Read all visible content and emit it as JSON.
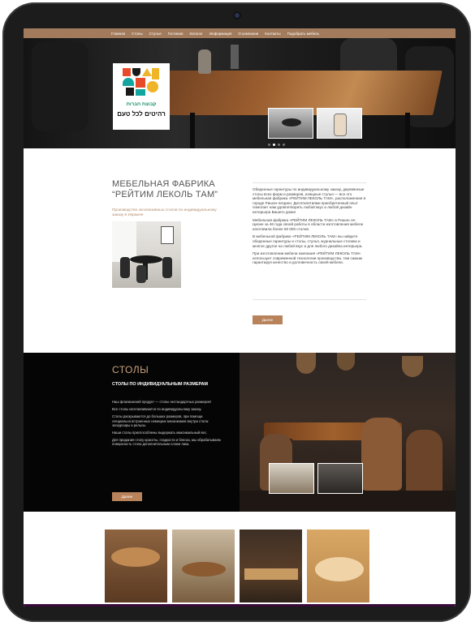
{
  "nav": {
    "items": [
      "Главная",
      "Столы",
      "Стулья",
      "Гостиная",
      "Каталог",
      "Информация",
      "О компании",
      "Контакты",
      "Подобрать мебель"
    ]
  },
  "logo": {
    "line1": "קבוצת חברות",
    "line2": "רהיטים לכל טעם"
  },
  "about": {
    "title": "МЕБЕЛЬНАЯ ФАБРИКА “РЕЙТИМ ЛЕКОЛЬ ТАМ”",
    "subtitle": "Производство эксклюзивных столов по индивидуальному заказу в Израиле",
    "paragraphs": [
      "Обеденные гарнитуры по индивидуальному заказу, деревянные столы всех форм и размеров, изящные стулья — все это мебельная фабрика «РЕЙТИМ ЛЕКОЛЬ ТАМ», расположенная в городе Ришон-леЦион. Десятилетиями приобретенный опыт помогает нам удовлетворить любой вкус и любой дизайн интерьера Вашего дома!",
      "Мебельная фабрика «РЕЙТИМ ЛЕКОЛЬ ТАМ» в Ришон ле-Ционе за 46 года своей работы в области изготовления мебели изготовила более 50 000 столов.",
      "В мебельной фабрике «РЕЙТИМ ЛЕКОЛЬ ТАМ» вы найдете обеденные гарнитуры и столы, стулья, журнальные столики и многое другое на любой вкус и для любого дизайна интерьера.",
      "При изготовлении мебели компания «РЕЙТИМ ЛЕКОЛЬ ТАМ» использует современной технологии производства, тем самым гарантируя качество и долговечность своей мебели."
    ],
    "button": "Далее"
  },
  "tables": {
    "title": "СТОЛЫ",
    "subtitle": "СТОЛЫ ПО ИНДИВИДУАЛЬНЫМ РАЗМЕРАМ",
    "paragraphs": [
      "Наш флагманский продукт — столы нестандартных размеров!",
      "Все столы изготавливаются по индивидуальному заказу.",
      "Столы раскрываются до больших размеров, при помощи специально встроенных немецких механизмов внутри стола: экскурсиры и рельсы.",
      "Наши столы приспособлены выдержать максимальный вес.",
      "Для придания столу красоты, гладкости и блеска, мы обрабатываем поверхность стола дополнительным слоем лака."
    ],
    "button": "Далее"
  },
  "colors": {
    "accent": "#a27b5c",
    "button": "#b8825a",
    "tables_title": "#c9a27d",
    "dark": "#050505"
  }
}
